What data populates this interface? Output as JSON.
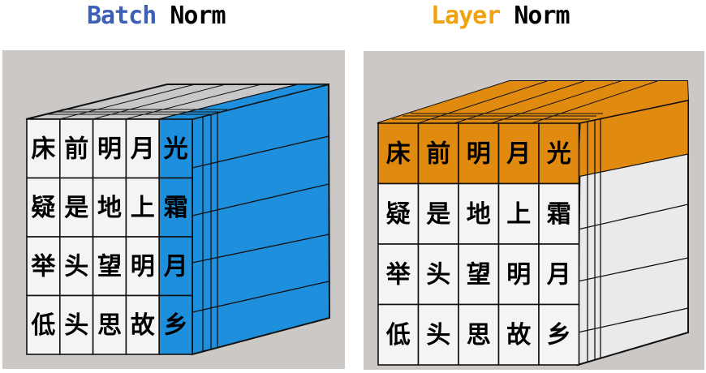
{
  "left_title": {
    "accent": "Batch",
    "rest": "Norm"
  },
  "right_title": {
    "accent": "Layer",
    "rest": "Norm"
  },
  "colors": {
    "batch_accent_text": "#3d5fb8",
    "layer_accent_text": "#f0a20f",
    "batch_highlight": "#1e8fdc",
    "layer_highlight": "#e08a10",
    "panel_background": "#cbc8c6",
    "cube_top": "#c8c8c8",
    "cube_side": "#eaeaea",
    "cell_face": "#f4f4f4"
  },
  "grid": [
    [
      "床",
      "前",
      "明",
      "月",
      "光"
    ],
    [
      "疑",
      "是",
      "地",
      "上",
      "霜"
    ],
    [
      "举",
      "头",
      "望",
      "明",
      "月"
    ],
    [
      "低",
      "头",
      "思",
      "故",
      "乡"
    ]
  ]
}
